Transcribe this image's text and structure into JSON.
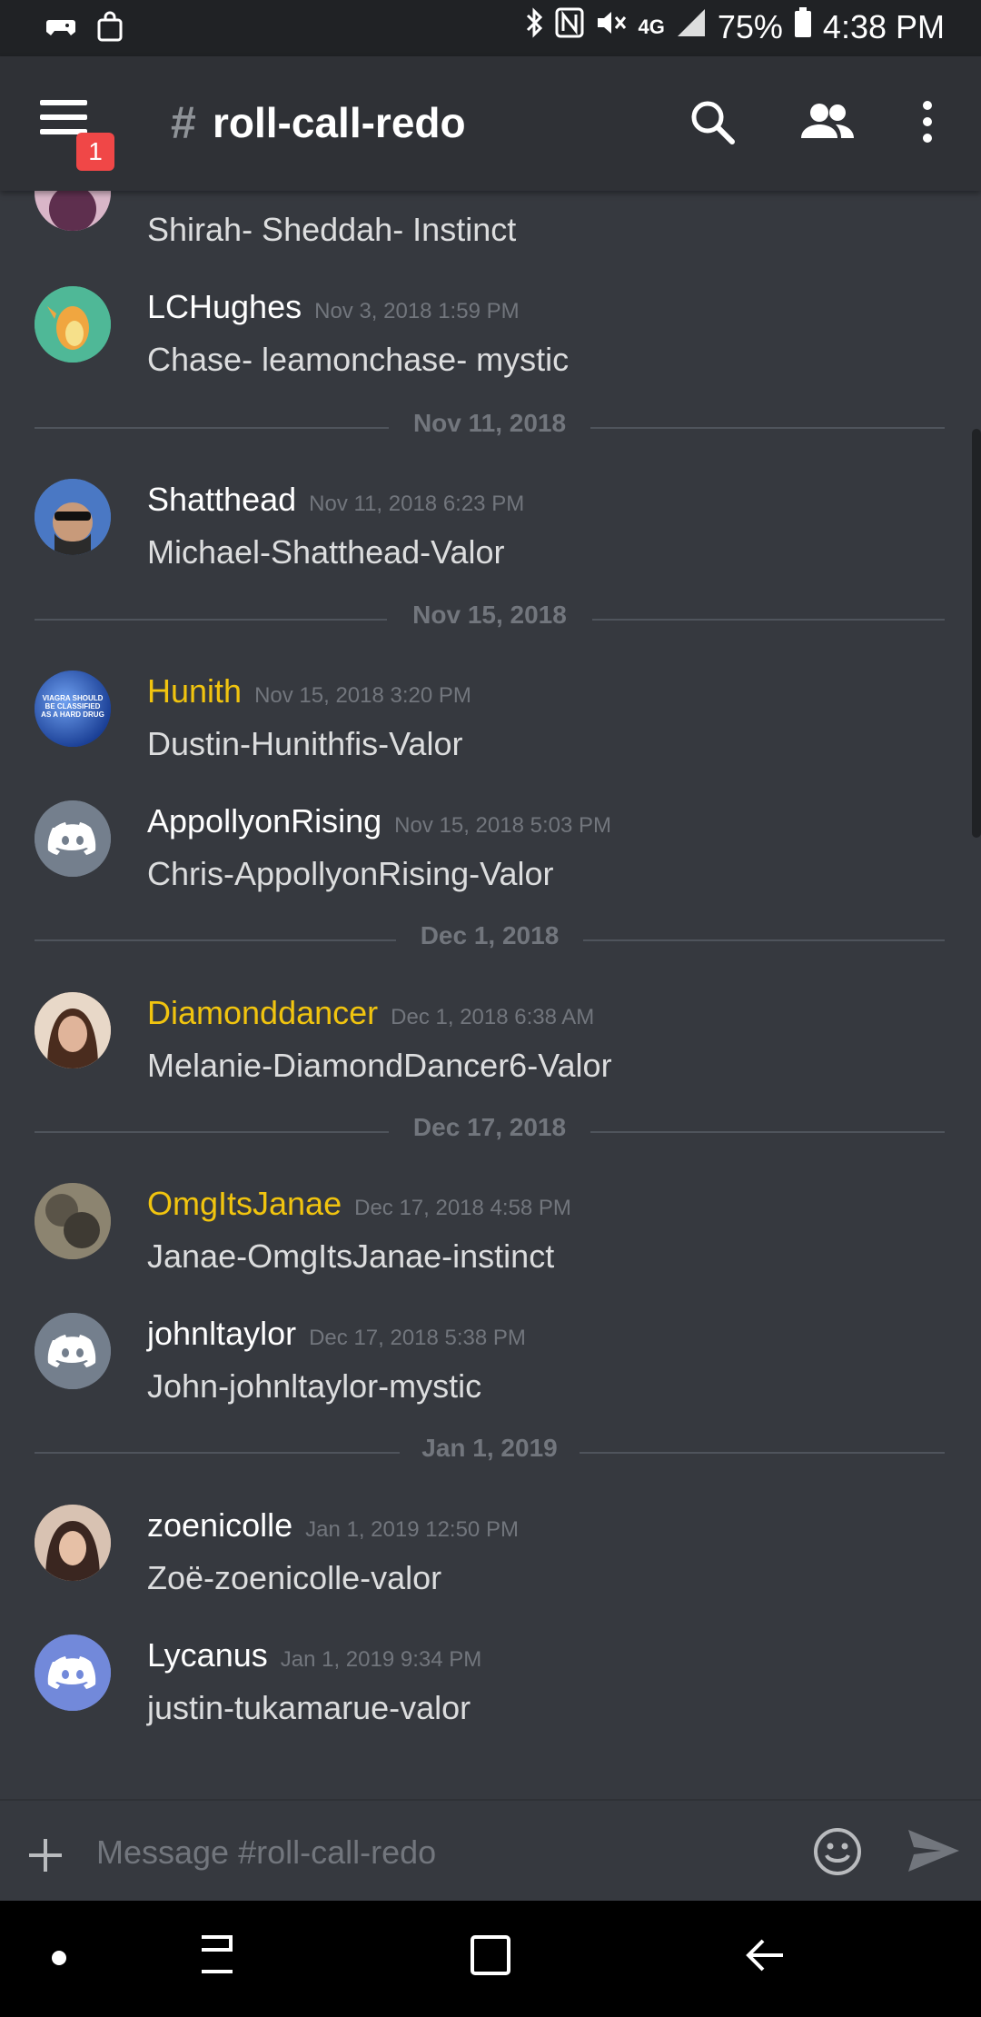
{
  "status_bar": {
    "battery": "75%",
    "time": "4:38 PM",
    "network": "4G",
    "icons": [
      "game-controller-icon",
      "shopping-bag-icon",
      "bluetooth-icon",
      "nfc-icon",
      "mute-icon",
      "signal-icon",
      "battery-icon"
    ]
  },
  "header": {
    "hash": "#",
    "channel": "roll-call-redo",
    "badge": "1",
    "icons": [
      "menu-icon",
      "search-icon",
      "members-icon",
      "more-icon"
    ]
  },
  "messages": [
    {
      "author": "",
      "timestamp": "",
      "content": "Shirah- Sheddah- Instinct",
      "color": "#ffffff"
    },
    {
      "author": "LCHughes",
      "timestamp": "Nov 3, 2018 1:59 PM",
      "content": "Chase- leamonchase- mystic",
      "color": "#ffffff"
    },
    {
      "divider": "Nov 11, 2018"
    },
    {
      "author": "Shatthead",
      "timestamp": "Nov 11, 2018 6:23 PM",
      "content": "Michael-Shatthead-Valor",
      "color": "#ffffff"
    },
    {
      "divider": "Nov 15, 2018"
    },
    {
      "author": "Hunith",
      "timestamp": "Nov 15, 2018 3:20 PM",
      "content": "Dustin-Hunithfis-Valor",
      "color": "#f1c40f"
    },
    {
      "author": "AppollyonRising",
      "timestamp": "Nov 15, 2018 5:03 PM",
      "content": "Chris-AppollyonRising-Valor",
      "color": "#ffffff"
    },
    {
      "divider": "Dec 1, 2018"
    },
    {
      "author": "Diamonddancer",
      "timestamp": "Dec 1, 2018 6:38 AM",
      "content": "Melanie-DiamondDancer6-Valor",
      "color": "#f1c40f"
    },
    {
      "divider": "Dec 17, 2018"
    },
    {
      "author": "OmgItsJanae",
      "timestamp": "Dec 17, 2018 4:58 PM",
      "content": "Janae-OmgItsJanae-instinct",
      "color": "#f1c40f"
    },
    {
      "author": "johnltaylor",
      "timestamp": "Dec 17, 2018 5:38 PM",
      "content": "John-johnltaylor-mystic",
      "color": "#ffffff"
    },
    {
      "divider": "Jan 1, 2019"
    },
    {
      "author": "zoenicolle",
      "timestamp": "Jan 1, 2019 12:50 PM",
      "content": "Zoë-zoenicolle-valor",
      "color": "#ffffff"
    },
    {
      "author": "Lycanus",
      "timestamp": "Jan 1, 2019 9:34 PM",
      "content": "justin-tukamarue-valor",
      "color": "#ffffff"
    }
  ],
  "avatar_text": {
    "hunith": "VIAGRA SHOULD BE CLASSIFIED AS A HARD DRUG"
  },
  "composer": {
    "placeholder": "Message #roll-call-redo",
    "icons": [
      "plus-icon",
      "emoji-icon",
      "send-icon"
    ]
  },
  "nav_bar": {
    "icons": [
      "dot-icon",
      "recents-icon",
      "home-icon",
      "back-icon"
    ]
  }
}
